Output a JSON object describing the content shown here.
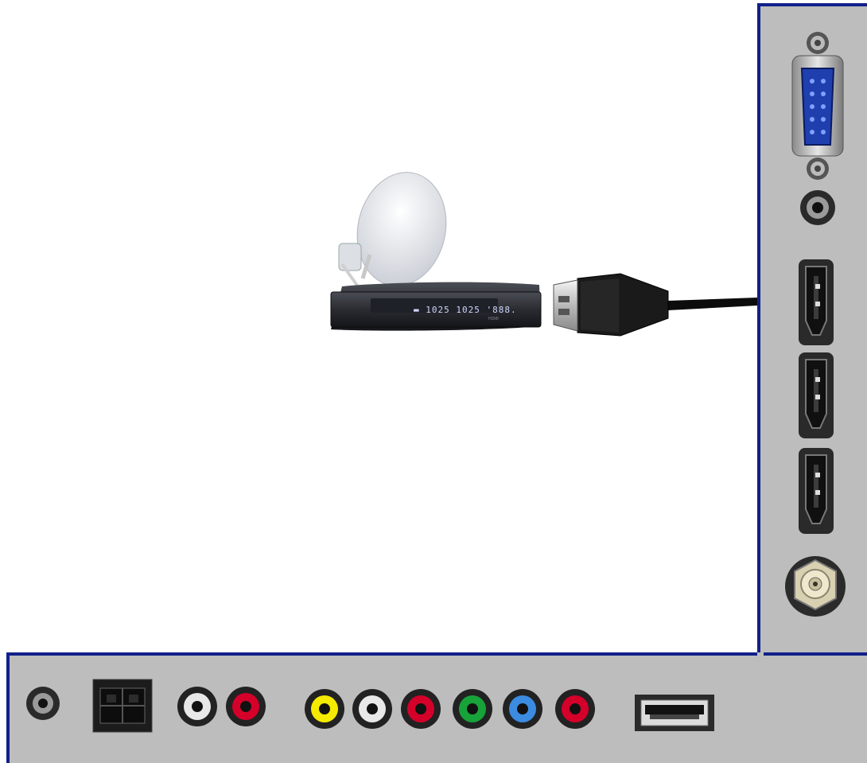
{
  "device": {
    "display_readout": "▬ 1025 1025 '888.",
    "brand_label": "HDMI"
  },
  "colors": {
    "panel_background": "#bdbdbd",
    "panel_border": "#12208a",
    "rca_yellow": "#f4ea00",
    "rca_white": "#e8e8e8",
    "rca_red": "#d4002a",
    "rca_green": "#18a23a",
    "rca_blue": "#3b8be0"
  },
  "icons": {
    "vga": "vga-port-icon",
    "audio_jack": "audio-jack-icon",
    "hdmi": "hdmi-port-icon",
    "coax": "coax-port-icon",
    "optical": "optical-port-icon",
    "rca": "rca-jack-icon",
    "usb": "usb-port-icon",
    "satellite_receiver": "satellite-receiver-icon",
    "hdmi_cable": "hdmi-cable-icon"
  }
}
